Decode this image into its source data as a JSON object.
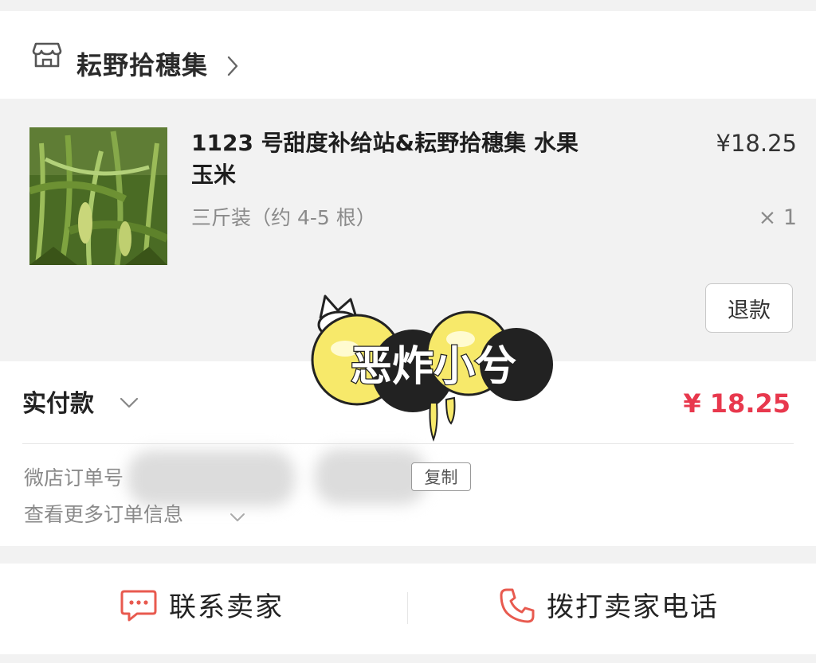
{
  "shop": {
    "name": "耘野拾穗集"
  },
  "item": {
    "title": "1123 号甜度补给站&耘野拾穗集 水果玉米",
    "spec": "三斤装（约 4-5 根）",
    "price": "¥18.25",
    "quantity": "× 1",
    "refund_label": "退款"
  },
  "payment": {
    "label": "实付款",
    "amount": "¥ 18.25",
    "amount_color": "#e8384d"
  },
  "order": {
    "number_label": "微店订单号",
    "copy_label": "复制",
    "more_info_label": "查看更多订单信息"
  },
  "bottom_bar": {
    "contact_label": "联系卖家",
    "call_label": "拨打卖家电话",
    "icon_color": "#e85a4f"
  },
  "icons": {
    "shop": "store-icon",
    "shop_chevron": "chevron-right-icon",
    "pay_chevron": "chevron-down-icon",
    "more_chevron": "chevron-down-icon",
    "contact": "chat-bubble-icon",
    "call": "phone-icon"
  },
  "watermark": {
    "text": "恶炸小兮"
  }
}
